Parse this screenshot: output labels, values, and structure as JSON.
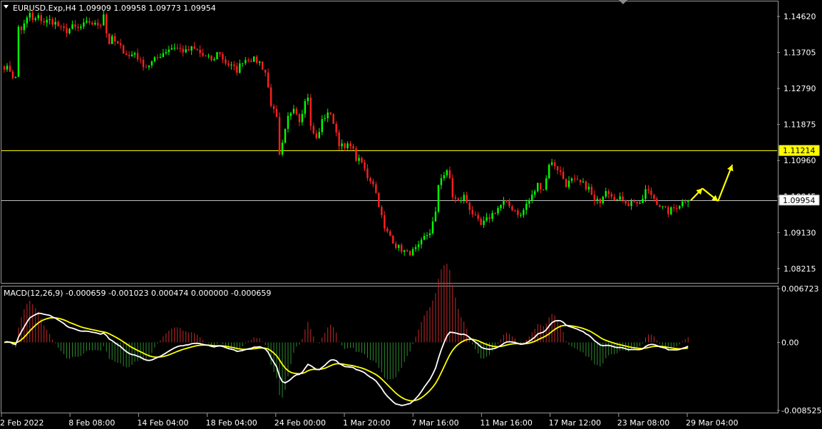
{
  "chart_data": [
    {
      "type": "candlestick",
      "symbol_header": "EURUSD.Exp,H4  1.09909 1.09958 1.09773 1.09954",
      "ylim": [
        1.0785,
        1.15
      ],
      "y_ticks": [
        "1.14620",
        "1.13705",
        "1.12790",
        "1.11875",
        "1.10960",
        "1.10045",
        "1.09130",
        "1.08215"
      ],
      "horizontal_lines": [
        {
          "value": 1.11214,
          "label": "1.11214",
          "color": "#ffff00"
        },
        {
          "value": 1.09954,
          "label": "1.09954",
          "color": "#c0c0c0"
        }
      ],
      "colors": {
        "bull": "#00ff00",
        "bear": "#ff2020"
      },
      "projection_arrow_color": "#ffff00",
      "anchors": [
        [
          0,
          1.1335
        ],
        [
          1,
          1.133
        ],
        [
          2,
          1.1325
        ],
        [
          3,
          1.131
        ],
        [
          4,
          1.1305
        ],
        [
          5,
          1.1435
        ],
        [
          6,
          1.143
        ],
        [
          7,
          1.144
        ],
        [
          8,
          1.1455
        ],
        [
          9,
          1.147
        ],
        [
          10,
          1.145
        ],
        [
          12,
          1.146
        ],
        [
          14,
          1.1448
        ],
        [
          16,
          1.1452
        ],
        [
          18,
          1.1445
        ],
        [
          20,
          1.143
        ],
        [
          22,
          1.1425
        ],
        [
          24,
          1.1435
        ],
        [
          26,
          1.143
        ],
        [
          28,
          1.144
        ],
        [
          30,
          1.1448
        ],
        [
          32,
          1.144
        ],
        [
          34,
          1.1445
        ],
        [
          35,
          1.147
        ],
        [
          36,
          1.142
        ],
        [
          37,
          1.1395
        ],
        [
          38,
          1.1405
        ],
        [
          40,
          1.139
        ],
        [
          42,
          1.1375
        ],
        [
          44,
          1.136
        ],
        [
          46,
          1.137
        ],
        [
          48,
          1.1345
        ],
        [
          50,
          1.1335
        ],
        [
          52,
          1.1345
        ],
        [
          54,
          1.1358
        ],
        [
          56,
          1.137
        ],
        [
          58,
          1.138
        ],
        [
          60,
          1.1385
        ],
        [
          62,
          1.1378
        ],
        [
          64,
          1.1372
        ],
        [
          66,
          1.138
        ],
        [
          68,
          1.1375
        ],
        [
          70,
          1.1362
        ],
        [
          72,
          1.1355
        ],
        [
          74,
          1.135
        ],
        [
          75,
          1.1375
        ],
        [
          76,
          1.1365
        ],
        [
          78,
          1.1345
        ],
        [
          80,
          1.1335
        ],
        [
          82,
          1.1325
        ],
        [
          84,
          1.135
        ],
        [
          86,
          1.1355
        ],
        [
          88,
          1.1352
        ],
        [
          90,
          1.1345
        ],
        [
          92,
          1.132
        ],
        [
          94,
          1.124
        ],
        [
          96,
          1.12
        ],
        [
          97,
          1.1105
        ],
        [
          98,
          1.1135
        ],
        [
          100,
          1.1205
        ],
        [
          102,
          1.1235
        ],
        [
          104,
          1.12
        ],
        [
          106,
          1.1245
        ],
        [
          107,
          1.126
        ],
        [
          108,
          1.118
        ],
        [
          110,
          1.115
        ],
        [
          112,
          1.1195
        ],
        [
          114,
          1.122
        ],
        [
          116,
          1.1195
        ],
        [
          118,
          1.114
        ],
        [
          120,
          1.1125
        ],
        [
          122,
          1.114
        ],
        [
          124,
          1.11
        ],
        [
          126,
          1.109
        ],
        [
          128,
          1.1055
        ],
        [
          130,
          1.104
        ],
        [
          132,
          1.0985
        ],
        [
          134,
          1.092
        ],
        [
          136,
          1.0905
        ],
        [
          138,
          1.088
        ],
        [
          140,
          1.087
        ],
        [
          142,
          1.086
        ],
        [
          144,
          1.0865
        ],
        [
          146,
          1.0875
        ],
        [
          148,
          1.09
        ],
        [
          150,
          1.0915
        ],
        [
          152,
          1.096
        ],
        [
          153,
          1.1035
        ],
        [
          154,
          1.1055
        ],
        [
          156,
          1.1065
        ],
        [
          157,
          1.105
        ],
        [
          158,
          1.1005
        ],
        [
          160,
          1.099
        ],
        [
          162,
          1.1005
        ],
        [
          164,
          1.0975
        ],
        [
          166,
          1.095
        ],
        [
          168,
          1.093
        ],
        [
          170,
          1.0945
        ],
        [
          172,
          1.096
        ],
        [
          174,
          1.0975
        ],
        [
          176,
          1.099
        ],
        [
          178,
          1.098
        ],
        [
          180,
          1.097
        ],
        [
          182,
          1.0955
        ],
        [
          184,
          1.0985
        ],
        [
          186,
          1.1005
        ],
        [
          188,
          1.1035
        ],
        [
          190,
          1.1025
        ],
        [
          191,
          1.105
        ],
        [
          192,
          1.109
        ],
        [
          194,
          1.1085
        ],
        [
          196,
          1.1065
        ],
        [
          198,
          1.1035
        ],
        [
          200,
          1.1045
        ],
        [
          202,
          1.104
        ],
        [
          204,
          1.1035
        ],
        [
          206,
          1.1025
        ],
        [
          208,
          1.099
        ],
        [
          210,
          1.0995
        ],
        [
          212,
          1.1025
        ],
        [
          214,
          1.101
        ],
        [
          216,
          1.0995
        ],
        [
          218,
          1.1
        ],
        [
          220,
          1.0985
        ],
        [
          222,
          1.0995
        ],
        [
          224,
          1.098
        ],
        [
          226,
          1.102
        ],
        [
          228,
          1.101
        ],
        [
          230,
          1.099
        ],
        [
          232,
          1.0975
        ],
        [
          234,
          1.0965
        ],
        [
          236,
          1.0975
        ],
        [
          238,
          1.0985
        ],
        [
          240,
          1.0995
        ],
        [
          241,
          1.0995
        ]
      ],
      "ohlc": [],
      "projection": [
        [
          1.0995,
          1.1025
        ],
        [
          1.1025,
          1.0993
        ],
        [
          1.0993,
          1.1085
        ]
      ]
    },
    {
      "type": "macd",
      "title": "MACD(12,26,9) -0.000659 -0.001023 0.000474 0.000000 -0.000659",
      "ylim": [
        -0.0088,
        0.007
      ],
      "y_ticks": [
        {
          "label": "0.006723",
          "value": 0.006723
        },
        {
          "label": "0.00",
          "value": 0.0
        },
        {
          "label": "-0.008525",
          "value": -0.008525
        }
      ],
      "colors": {
        "hist_pos": "#c82828",
        "hist_neg": "#2e8b2e",
        "macd": "#ffffff",
        "signal": "#ffff00"
      },
      "histogram": [],
      "macd": [],
      "signal": []
    }
  ],
  "x_axis_labels": [
    "2 Feb 2022",
    "8 Feb 08:00",
    "14 Feb 04:00",
    "18 Feb 04:00",
    "24 Feb 00:00",
    "1 Mar 20:00",
    "7 Mar 16:00",
    "11 Mar 16:00",
    "17 Mar 12:00",
    "23 Mar 08:00",
    "29 Mar 04:00"
  ]
}
